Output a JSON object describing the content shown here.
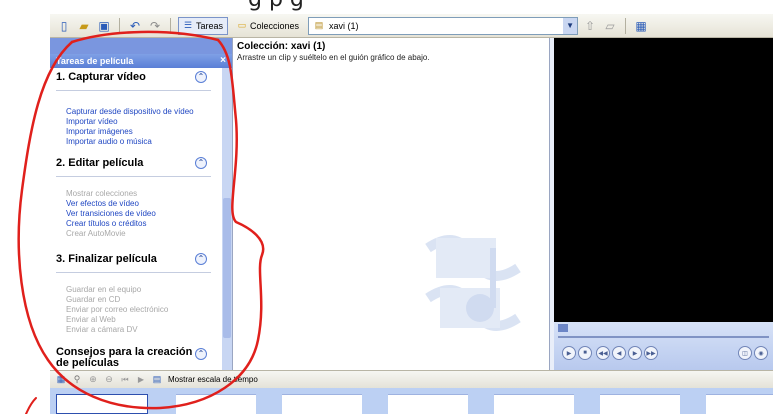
{
  "caption_fragment": "g                   p          g",
  "toolbar": {
    "icons": [
      "new-project-icon",
      "open-icon",
      "save-icon",
      "undo-icon",
      "redo-icon"
    ],
    "tasks_label": "Tareas",
    "collections_label": "Colecciones",
    "collection_select_value": "xavi (1)",
    "collection_nav_icons": [
      "up-folder-icon",
      "new-folder-icon",
      "views-icon"
    ]
  },
  "task_pane": {
    "header": "Tareas de película",
    "sections": [
      {
        "title": "1. Capturar vídeo",
        "items": [
          {
            "label": "Capturar desde dispositivo de vídeo",
            "enabled": true
          },
          {
            "label": "Importar vídeo",
            "enabled": true
          },
          {
            "label": "Importar imágenes",
            "enabled": true
          },
          {
            "label": "Importar audio o música",
            "enabled": true
          }
        ]
      },
      {
        "title": "2. Editar película",
        "items": [
          {
            "label": "Mostrar colecciones",
            "enabled": false
          },
          {
            "label": "Ver efectos de vídeo",
            "enabled": true
          },
          {
            "label": "Ver transiciones de vídeo",
            "enabled": true
          },
          {
            "label": "Crear títulos o créditos",
            "enabled": true
          },
          {
            "label": "Crear AutoMovie",
            "enabled": false
          }
        ]
      },
      {
        "title": "3. Finalizar película",
        "items": [
          {
            "label": "Guardar en el equipo",
            "enabled": false
          },
          {
            "label": "Guardar en CD",
            "enabled": false
          },
          {
            "label": "Enviar por correo electrónico",
            "enabled": false
          },
          {
            "label": "Enviar al Web",
            "enabled": false
          },
          {
            "label": "Enviar a cámara DV",
            "enabled": false
          }
        ]
      },
      {
        "title": "Consejos para la creación de películas",
        "items": []
      }
    ]
  },
  "collection_pane": {
    "title": "Colección: xavi (1)",
    "subtitle": "Arrastre un clip y suéltelo en el guión gráfico de abajo."
  },
  "storyboard_toolbar": {
    "show_timeline_label": "Mostrar escala de tiempo"
  },
  "colors": {
    "task_link": "#1f46c2",
    "disabled_link": "#a8a8a8",
    "pane_blue": "#7a96df",
    "annotation_red": "#e0201c"
  }
}
